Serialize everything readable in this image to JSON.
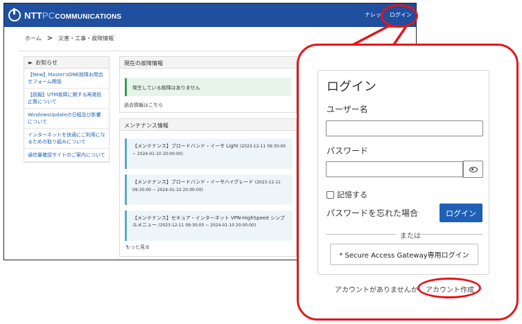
{
  "header": {
    "brand": {
      "ntt": "NTT",
      "pc": "PC",
      "comm": "COMMUNICATIONS"
    },
    "nav": {
      "knowledge": "ナレッ",
      "login": "ログイン"
    }
  },
  "breadcrumb": {
    "home": "ホーム",
    "separator": ">",
    "current": "災害・工事・故障情報"
  },
  "news": {
    "title": "お知らせ",
    "items": [
      "【New】Master'sONE故障お問合せフォーム開設",
      "【続報】UTM故障に関する再発防止策について",
      "WindowsUpdateの日程及び影響について",
      "インターネットを快適にご利用になるための取り組みについて",
      "通信量確認サイトのご案内について"
    ]
  },
  "fault": {
    "title": "現在の故障情報",
    "alert": "発生している故障はありません",
    "past_link": "過去情報はこちら"
  },
  "maintenance": {
    "title": "メンテナンス情報",
    "items": [
      {
        "label": "【メンテナンス】ブロードバンド・イーサ Light",
        "date": "(2023-12-11 09:30:00 ~ 2024-01-10 20:00:00)"
      },
      {
        "label": "【メンテナンス】ブロードバンド・イーサハイグレード",
        "date": "(2023-12-11 09:30:00 ~ 2024-01-10 20:00:00)"
      },
      {
        "label": "【メンテナンス】セキュア・インターネット VPN-HighSpeed シンプルメニュー",
        "date": "(2023-12-11 09:30:00 ~ 2024-01-10 20:00:00)"
      }
    ],
    "more": "もっと見る"
  },
  "login": {
    "title": "ログイン",
    "username_label": "ユーザー名",
    "password_label": "パスワード",
    "remember": "記憶する",
    "forgot": "パスワードを忘れた場合",
    "submit": "ログイン",
    "or": "または",
    "sag_button": "* Secure Access Gateway専用ログイン",
    "no_account": "アカウントがありませんか",
    "create_account": "アカウント作成"
  },
  "colors": {
    "brand_blue": "#1f4f9e",
    "button_blue": "#1f5fb5",
    "annotation_red": "#e4141b"
  }
}
